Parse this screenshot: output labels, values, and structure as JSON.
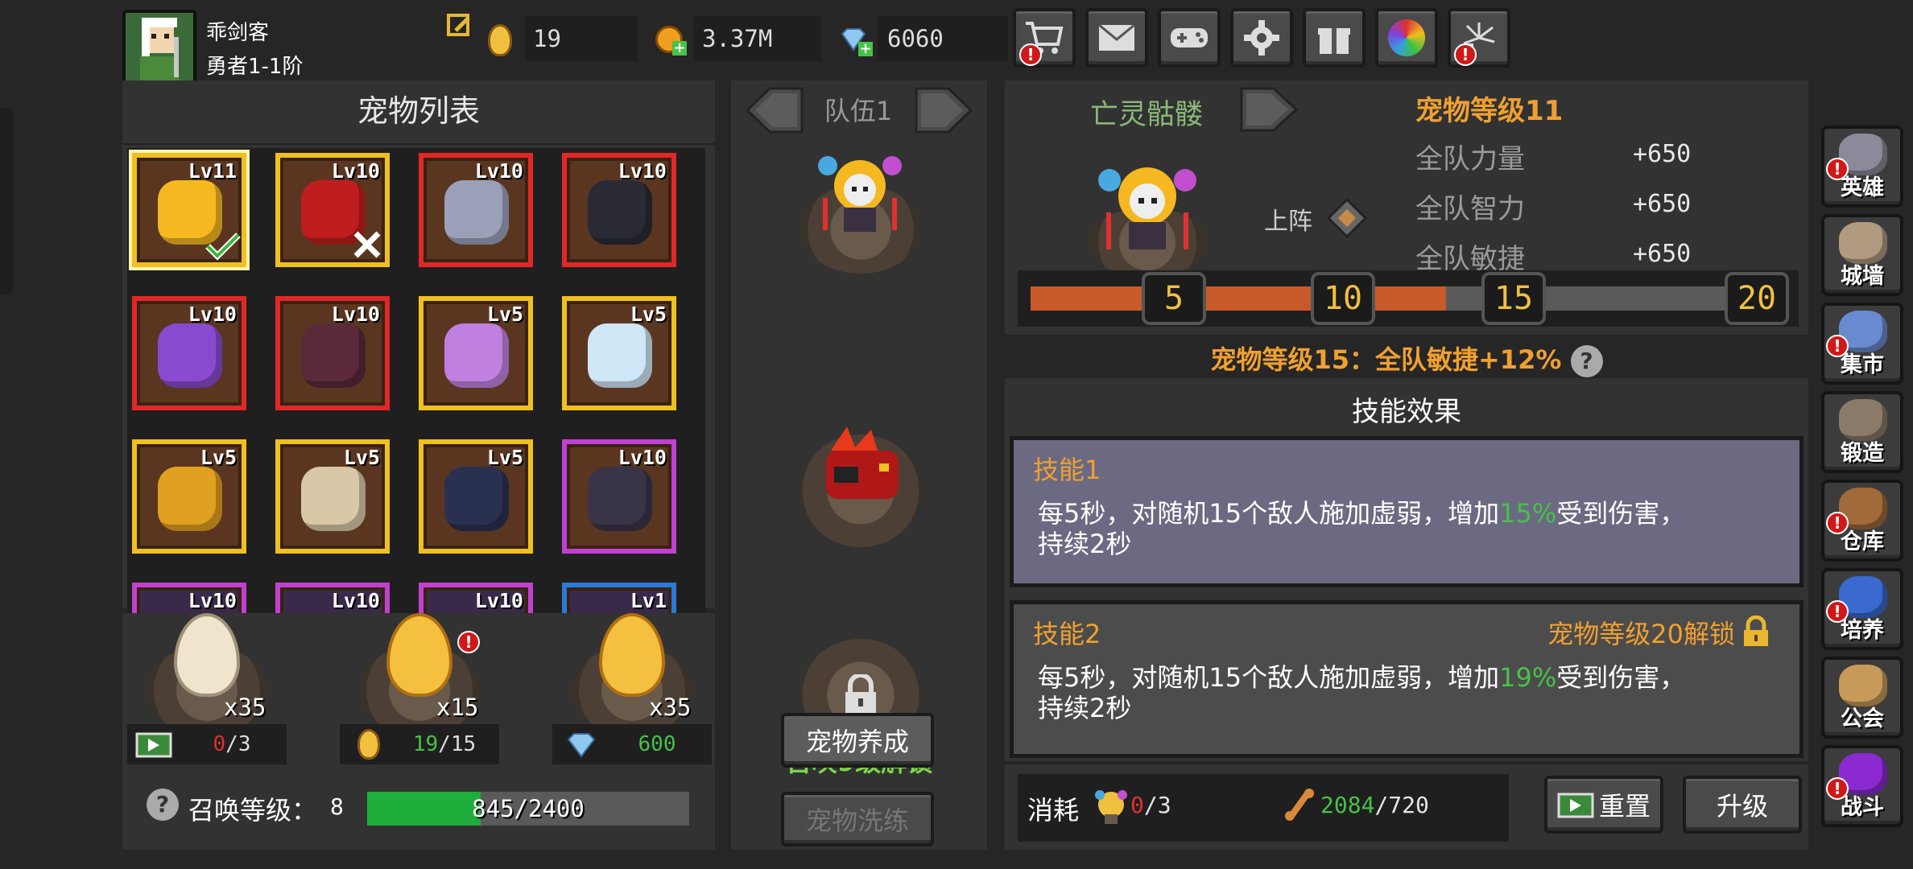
{
  "player": {
    "name": "乖剑客",
    "rank": "勇者1-1阶"
  },
  "currencies": [
    {
      "icon": "egg-icon",
      "value": "19"
    },
    {
      "icon": "gold-coin-plus-icon",
      "value": "3.37M"
    },
    {
      "icon": "diamond-plus-icon",
      "value": "6060"
    }
  ],
  "top_buttons": [
    {
      "icon": "shopping-cart-icon",
      "alert": true
    },
    {
      "icon": "mail-icon",
      "alert": false
    },
    {
      "icon": "gamepad-icon",
      "alert": false
    },
    {
      "icon": "gear-icon",
      "alert": false
    },
    {
      "icon": "gift-icon",
      "alert": false
    },
    {
      "icon": "color-wheel-icon",
      "alert": false
    },
    {
      "icon": "firework-icon",
      "alert": true
    }
  ],
  "pet_list": {
    "title": "宠物列表",
    "pets": [
      {
        "level": "Lv11",
        "frame": "#f0c020",
        "selected": true,
        "state": "checked",
        "icon": "flaming-skull-icon"
      },
      {
        "level": "Lv10",
        "frame": "#f0c020",
        "state": "crossed",
        "icon": "fire-boar-icon"
      },
      {
        "level": "Lv10",
        "frame": "#e02828",
        "icon": "gray-bat-icon"
      },
      {
        "level": "Lv10",
        "frame": "#e02828",
        "icon": "grim-reaper-icon"
      },
      {
        "level": "Lv10",
        "frame": "#e02828",
        "icon": "purple-unicorn-icon"
      },
      {
        "level": "Lv10",
        "frame": "#e02828",
        "icon": "demon-bat-icon"
      },
      {
        "level": "Lv5",
        "frame": "#f0c020",
        "icon": "scorpion-icon"
      },
      {
        "level": "Lv5",
        "frame": "#f0c020",
        "icon": "ice-cat-icon"
      },
      {
        "level": "Lv5",
        "frame": "#f0c020",
        "icon": "flower-lizard-icon"
      },
      {
        "level": "Lv5",
        "frame": "#f0c020",
        "icon": "horned-shaman-icon"
      },
      {
        "level": "Lv5",
        "frame": "#f0c020",
        "icon": "dark-bat-icon"
      },
      {
        "level": "Lv10",
        "frame": "#c040d0",
        "icon": "shadow-spider-icon"
      }
    ],
    "partial_row": [
      {
        "level": "Lv10",
        "frame": "#c040d0"
      },
      {
        "level": "Lv10",
        "frame": "#c040d0"
      },
      {
        "level": "Lv10",
        "frame": "#c040d0"
      },
      {
        "level": "Lv1",
        "frame": "#2a7ad8"
      }
    ]
  },
  "eggs": [
    {
      "type": "white",
      "count": "x35",
      "cost_icon": "video-ad-icon",
      "cost_current": "0",
      "cost_total": "/3",
      "cost_current_color": "#e03030",
      "alert": false
    },
    {
      "type": "gold",
      "count": "x15",
      "cost_icon": "egg-icon",
      "cost_current": "19",
      "cost_total": "/15",
      "cost_current_color": "#46c248",
      "alert": true
    },
    {
      "type": "gold",
      "count": "x35",
      "cost_icon": "diamond-icon",
      "cost_current": "600",
      "cost_total": "",
      "cost_current_color": "#46c248",
      "alert": false
    }
  ],
  "summon": {
    "label": "召唤等级：",
    "level": "8",
    "progress_text": "845/2400",
    "progress_fraction": 0.352
  },
  "team": {
    "title": "队伍1",
    "locked_text": "召唤9级解锁",
    "btn_train": "宠物养成",
    "btn_reroll": "宠物洗练"
  },
  "detail": {
    "pet_name": "亡灵骷髅",
    "pet_level": "宠物等级11",
    "deploy_label": "上阵",
    "stats": [
      {
        "name": "全队力量",
        "value": "+650"
      },
      {
        "name": "全队智力",
        "value": "+650"
      },
      {
        "name": "全队敏捷",
        "value": "+650"
      }
    ],
    "milestones": [
      "5",
      "10",
      "15",
      "20"
    ],
    "milestone_progress": 0.55,
    "next_bonus": "宠物等级15：全队敏捷+12%"
  },
  "skills": {
    "title": "技能效果",
    "items": [
      {
        "name": "技能1",
        "lock_text": "",
        "desc_before": "每5秒，对随机15个敌人施加虚弱，增加",
        "desc_value": "15%",
        "desc_after": "受到伤害，",
        "desc_line2": "持续2秒"
      },
      {
        "name": "技能2",
        "lock_text": "宠物等级20解锁",
        "desc_before": "每5秒，对随机15个敌人施加虚弱，增加",
        "desc_value": "19%",
        "desc_after": "受到伤害，",
        "desc_line2": "持续2秒"
      }
    ]
  },
  "cost_bar": {
    "label": "消耗",
    "item1_current": "0",
    "item1_total": "/3",
    "item2_current": "2084",
    "item2_total": "/720",
    "reset_label": "重置",
    "upgrade_label": "升级"
  },
  "side_menu": [
    {
      "label": "英雄",
      "icon": "helmet-icon",
      "alert": true
    },
    {
      "label": "城墙",
      "icon": "castle-wall-icon",
      "alert": false
    },
    {
      "label": "集市",
      "icon": "market-stall-icon",
      "alert": true
    },
    {
      "label": "锻造",
      "icon": "anvil-icon",
      "alert": false
    },
    {
      "label": "仓库",
      "icon": "storage-chest-icon",
      "alert": true
    },
    {
      "label": "培养",
      "icon": "trophy-icon",
      "alert": true
    },
    {
      "label": "公会",
      "icon": "guild-lion-icon",
      "alert": false
    },
    {
      "label": "战斗",
      "icon": "portal-icon",
      "alert": true
    }
  ]
}
